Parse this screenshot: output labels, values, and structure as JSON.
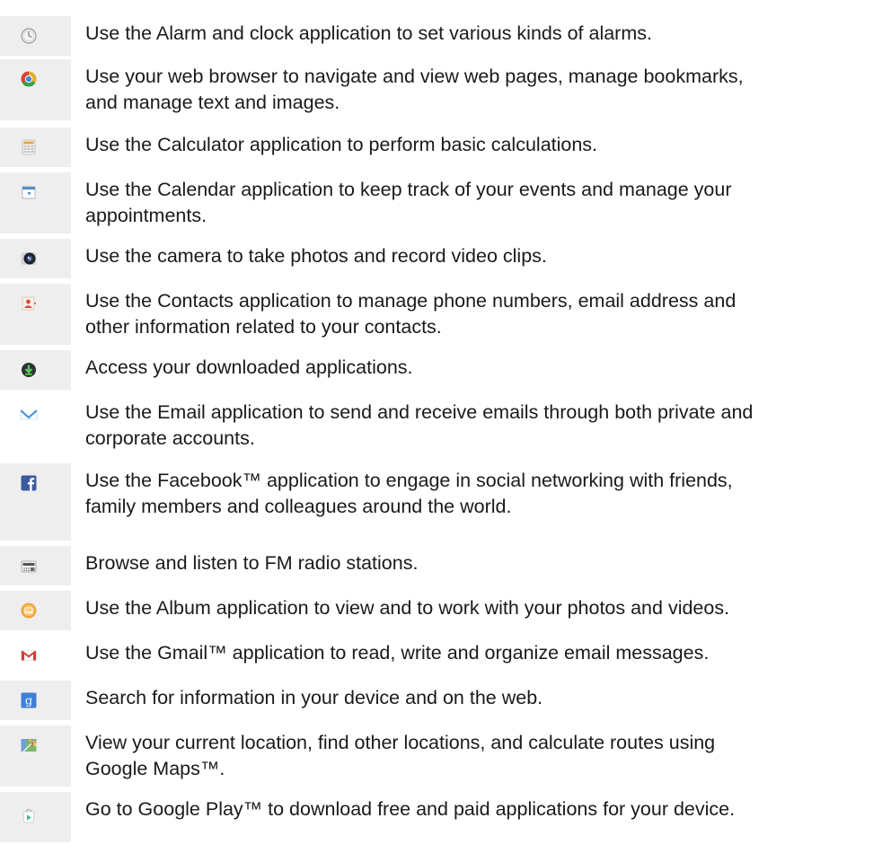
{
  "apps": [
    {
      "icon": "alarm-clock-icon",
      "description_lines": [
        "Use the Alarm and clock application to set various kinds of alarms."
      ]
    },
    {
      "icon": "browser-icon",
      "description_lines": [
        "Use your web browser to navigate and view web pages, manage bookmarks,",
        "and manage text and images."
      ]
    },
    {
      "icon": "calculator-icon",
      "description_lines": [
        "Use the Calculator application to perform basic calculations."
      ]
    },
    {
      "icon": "calendar-icon",
      "description_lines": [
        "Use the Calendar application to keep track of your events and manage your",
        "appointments."
      ]
    },
    {
      "icon": "camera-icon",
      "description_lines": [
        "Use the camera to take photos and record video clips."
      ]
    },
    {
      "icon": "contacts-icon",
      "description_lines": [
        "Use the Contacts application to manage phone numbers, email address and",
        "other information related to your contacts."
      ]
    },
    {
      "icon": "download-icon",
      "description_lines": [
        "Access your downloaded applications."
      ]
    },
    {
      "icon": "email-icon",
      "description_lines": [
        "Use the Email application to send and receive emails through both private and",
        "corporate accounts."
      ]
    },
    {
      "icon": "facebook-icon",
      "description_lines": [
        "Use the Facebook™ application to engage in social networking with friends,",
        "family members and colleagues around the world."
      ]
    },
    {
      "icon": "fm-radio-icon",
      "description_lines": [
        "Browse and listen to FM radio stations."
      ]
    },
    {
      "icon": "album-icon",
      "description_lines": [
        "Use the Album application to view and to work with your photos and videos."
      ]
    },
    {
      "icon": "gmail-icon",
      "description_lines": [
        "Use the Gmail™ application to read, write and organize email messages."
      ]
    },
    {
      "icon": "google-search-icon",
      "description_lines": [
        "Search for information in your device and on the web."
      ]
    },
    {
      "icon": "maps-icon",
      "description_lines": [
        "View your current location, find other locations, and calculate routes using",
        "Google Maps™."
      ]
    },
    {
      "icon": "play-store-icon",
      "description_lines": [
        "Go to Google Play™ to download free and paid applications for your device."
      ]
    }
  ]
}
